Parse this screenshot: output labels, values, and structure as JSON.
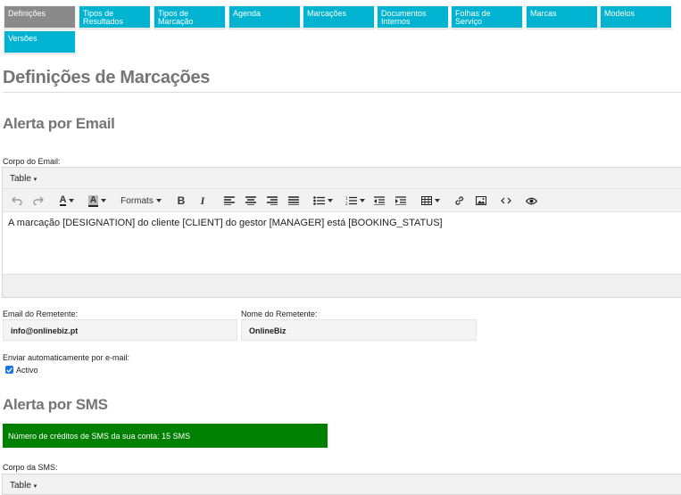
{
  "tabs": [
    {
      "label": "Definições",
      "active": true
    },
    {
      "label": "Tipos de Resultados"
    },
    {
      "label": "Tipos de Marcação"
    },
    {
      "label": "Agenda"
    },
    {
      "label": "Marcações"
    },
    {
      "label": "Documentos Internos"
    },
    {
      "label": "Folhas de Serviço"
    },
    {
      "label": "Marcas"
    },
    {
      "label": "Modelos"
    },
    {
      "label": "Versões"
    }
  ],
  "page_title": "Definições de Marcações",
  "email_alert": {
    "heading": "Alerta por Email",
    "body_label": "Corpo do Email:",
    "editor_menu": "Table",
    "formats_label": "Formats",
    "content": "A marcação [DESIGNATION] do cliente [CLIENT] do gestor [MANAGER] está [BOOKING_STATUS]",
    "sender_email_label": "Email do Remetente:",
    "sender_email_value": "info@onlinebiz.pt",
    "sender_name_label": "Nome do Remetente:",
    "sender_name_value": "OnlineBiz",
    "auto_send_label": "Enviar automaticamente por e-mail:",
    "active_label": "Activo",
    "active_checked": true
  },
  "sms_alert": {
    "heading": "Alerta por SMS",
    "credits_text": "Número de créditos de SMS da sua conta: 15 SMS",
    "body_label": "Corpo da SMS:",
    "editor_menu": "Table"
  },
  "toolbar_icons": [
    "undo-icon",
    "redo-icon",
    "text-color-icon",
    "background-color-icon",
    "formats-dropdown",
    "bold-icon",
    "italic-icon",
    "align-left-icon",
    "align-center-icon",
    "align-right-icon",
    "align-justify-icon",
    "bullet-list-icon",
    "numbered-list-icon",
    "outdent-icon",
    "indent-icon",
    "table-icon",
    "link-icon",
    "image-icon",
    "code-icon",
    "preview-icon"
  ],
  "colors": {
    "tab": "#00b3d1",
    "tab_active": "#8a8a8a",
    "heading": "#757575",
    "sms_bar": "#008000"
  }
}
